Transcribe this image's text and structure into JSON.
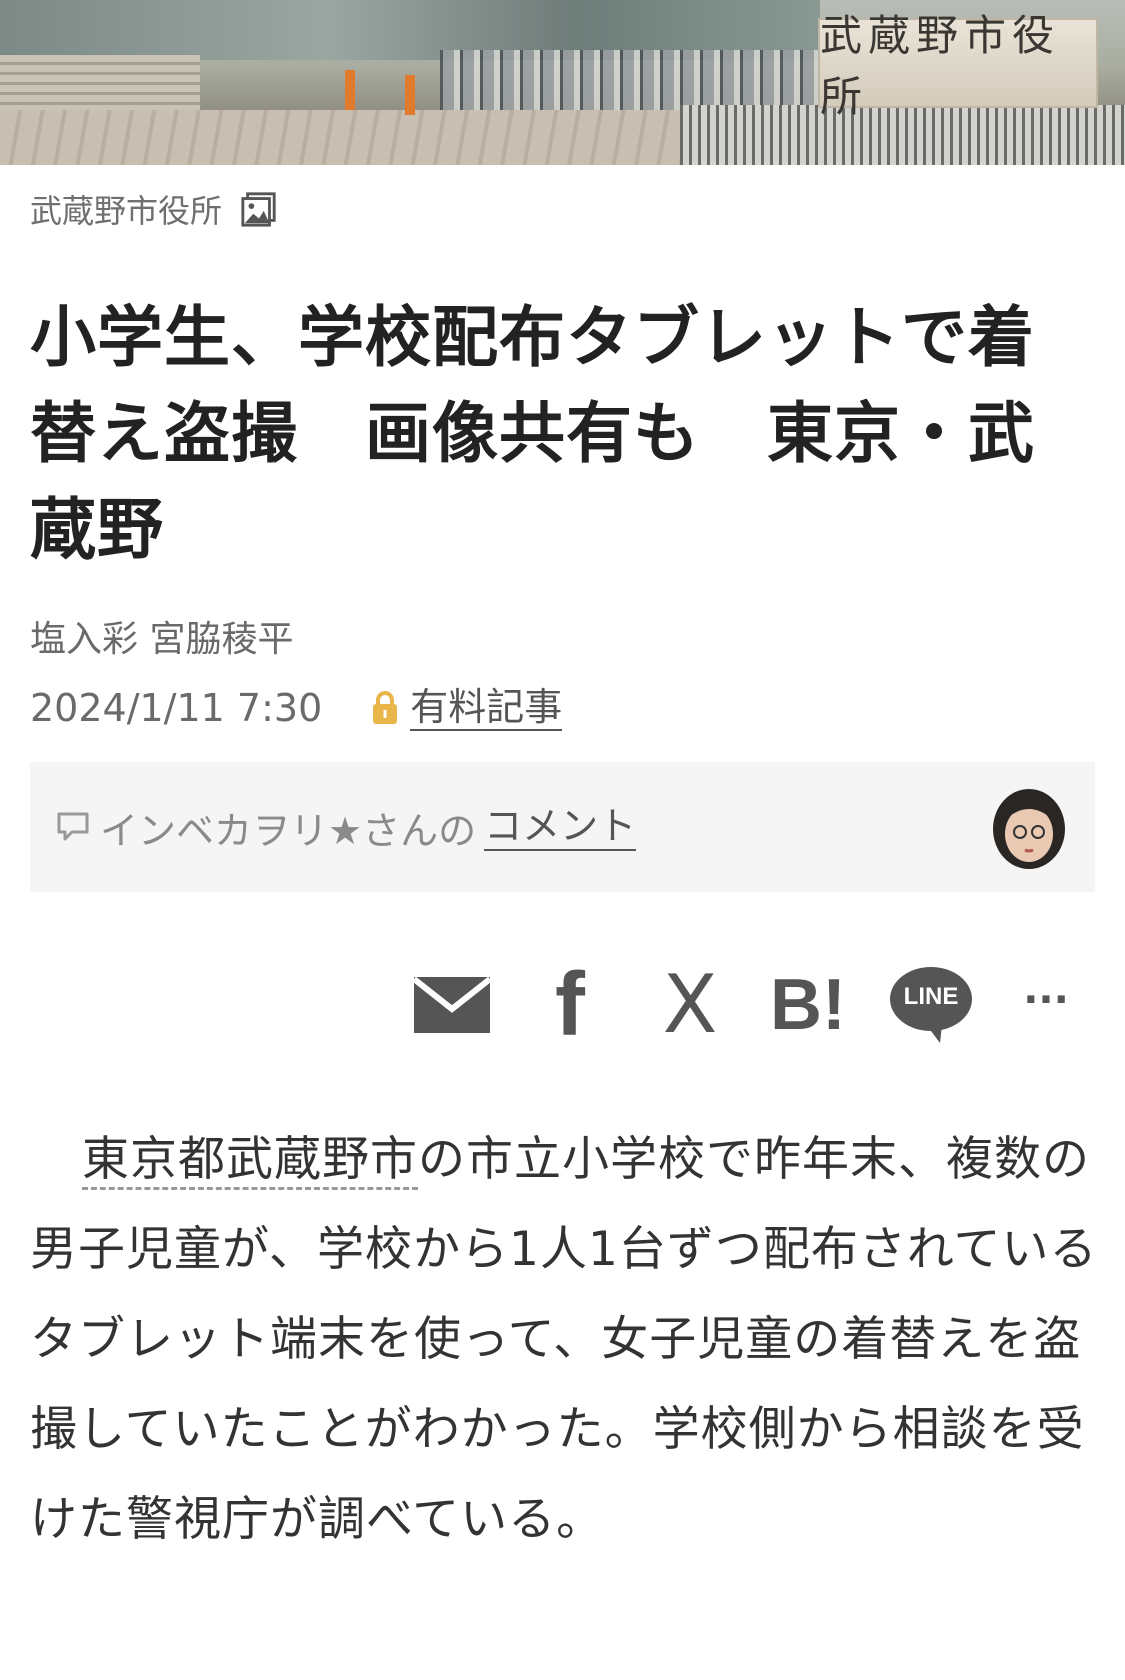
{
  "hero": {
    "sign_text": "武蔵野市役所"
  },
  "caption": {
    "text": "武蔵野市役所",
    "icon": "image-gallery-icon"
  },
  "article": {
    "title": "小学生、学校配布タブレットで着替え盗撮　画像共有も　東京・武蔵野",
    "authors": "塩入彩 宮脇稜平",
    "date": "2024/1/11 7:30",
    "paid_label": "有料記事",
    "paid_icon": "lock-icon",
    "body_link": "東京都武蔵野市",
    "body_rest": "の市立小学校で昨年末、複数の男子児童が、学校から1人1台ずつ配布されているタブレット端末を使って、女子児童の着替えを盗撮していたことがわかった。学校側から相談を受けた警視庁が調べている。"
  },
  "comment": {
    "icon": "comment-bubble-icon",
    "author_text": "インベカヲリ★さんの",
    "link_text": "コメント"
  },
  "share": {
    "items": [
      {
        "icon": "mail-icon"
      },
      {
        "icon": "facebook-icon",
        "text": "f"
      },
      {
        "icon": "x-icon",
        "text": "X"
      },
      {
        "icon": "hatena-bookmark-icon",
        "text": "B!"
      },
      {
        "icon": "line-icon",
        "text": "LINE"
      },
      {
        "icon": "more-icon",
        "text": "···"
      }
    ]
  },
  "colors": {
    "title": "#222222",
    "meta": "#6a6a6a",
    "lock": "#e8b64a",
    "share_icons": "#555555",
    "comment_bg": "#f5f5f5"
  }
}
